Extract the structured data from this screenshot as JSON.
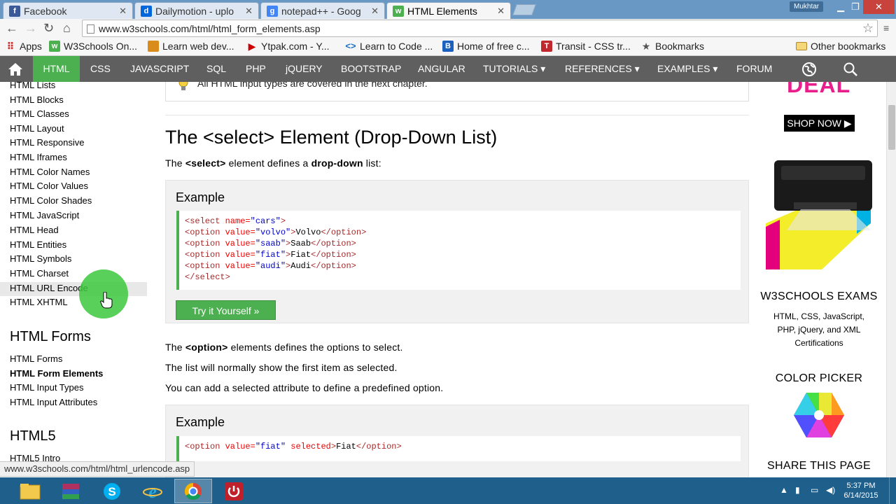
{
  "browser": {
    "tabs": [
      {
        "title": "Facebook",
        "favicon": "facebook-icon",
        "color": "#3b5998",
        "glyph": "f"
      },
      {
        "title": "Dailymotion - uplo",
        "favicon": "dailymotion-icon",
        "color": "#0066dc",
        "glyph": "d"
      },
      {
        "title": "notepad++ - Goog",
        "favicon": "google-icon",
        "color": "#4285f4",
        "glyph": "g"
      },
      {
        "title": "HTML Elements",
        "favicon": "w3schools-icon",
        "color": "#4caf50",
        "glyph": "w"
      }
    ],
    "user_name": "Mukhtar",
    "url": "www.w3schools.com/html/html_form_elements.asp",
    "bookmarks": [
      {
        "label": "Apps",
        "icon": "apps-grid-icon"
      },
      {
        "label": "W3Schools On...",
        "icon": "w3schools-icon"
      },
      {
        "label": "Learn web dev...",
        "icon": "learn-web-icon"
      },
      {
        "label": "Ytpak.com - Y...",
        "icon": "ytpak-icon"
      },
      {
        "label": "Learn to Code ...",
        "icon": "code-icon"
      },
      {
        "label": "Home of free c...",
        "icon": "blue-square-icon"
      },
      {
        "label": "Transit - CSS tr...",
        "icon": "transit-icon"
      },
      {
        "label": "Bookmarks",
        "icon": "star-icon"
      },
      {
        "label": "Other bookmarks",
        "icon": "folder-icon"
      }
    ]
  },
  "nav": {
    "items": [
      "HTML",
      "CSS",
      "JAVASCRIPT",
      "SQL",
      "PHP",
      "jQUERY",
      "BOOTSTRAP",
      "ANGULAR",
      "TUTORIALS ▾",
      "REFERENCES ▾",
      "EXAMPLES ▾",
      "FORUM"
    ],
    "active": "HTML"
  },
  "sidebar": {
    "html_items": [
      "HTML Lists",
      "HTML Blocks",
      "HTML Classes",
      "HTML Layout",
      "HTML Responsive",
      "HTML Iframes",
      "HTML Color Names",
      "HTML Color Values",
      "HTML Color Shades",
      "HTML JavaScript",
      "HTML Head",
      "HTML Entities",
      "HTML Symbols",
      "HTML Charset",
      "HTML URL Encode",
      "HTML XHTML"
    ],
    "forms_heading": "HTML Forms",
    "forms_items": [
      "HTML Forms",
      "HTML Form Elements",
      "HTML Input Types",
      "HTML Input Attributes"
    ],
    "html5_heading": "HTML5",
    "html5_items": [
      "HTML5 Intro"
    ]
  },
  "main": {
    "note": "All HTML input types are covered in the next chapter.",
    "heading": "The <select> Element (Drop-Down List)",
    "intro": {
      "pre": "The ",
      "tag": "<select>",
      "mid": " element defines a ",
      "bold": "drop-down",
      "post": " list:"
    },
    "example1": {
      "title": "Example",
      "lines": [
        "<select name=\"cars\">",
        "<option value=\"volvo\">Volvo</option>",
        "<option value=\"saab\">Saab</option>",
        "<option value=\"fiat\">Fiat</option>",
        "<option value=\"audi\">Audi</option>",
        "</select>"
      ],
      "button": "Try it Yourself »"
    },
    "p1": {
      "pre": "The ",
      "tag": "<option>",
      "post": " elements defines the options to select."
    },
    "p2": "The list will normally show the first item as selected.",
    "p3": "You can add a selected attribute to define a predefined option.",
    "example2": {
      "title": "Example",
      "line": "<option value=\"fiat\" selected>Fiat</option>"
    }
  },
  "right": {
    "deal": "DEAL",
    "shop_now": "SHOP NOW ▶",
    "exams_heading": "W3SCHOOLS EXAMS",
    "exams_text": "HTML, CSS, JavaScript, PHP, jQuery, and XML Certifications",
    "color_picker_heading": "COLOR PICKER",
    "share_heading": "SHARE THIS PAGE"
  },
  "status_url": "www.w3schools.com/html/html_urlencode.asp",
  "taskbar": {
    "time": "5:37 PM",
    "date": "6/14/2015"
  },
  "colors": {
    "accent": "#4caf50",
    "nav_bg": "#5f5f5f",
    "deal": "#e91e8c"
  }
}
